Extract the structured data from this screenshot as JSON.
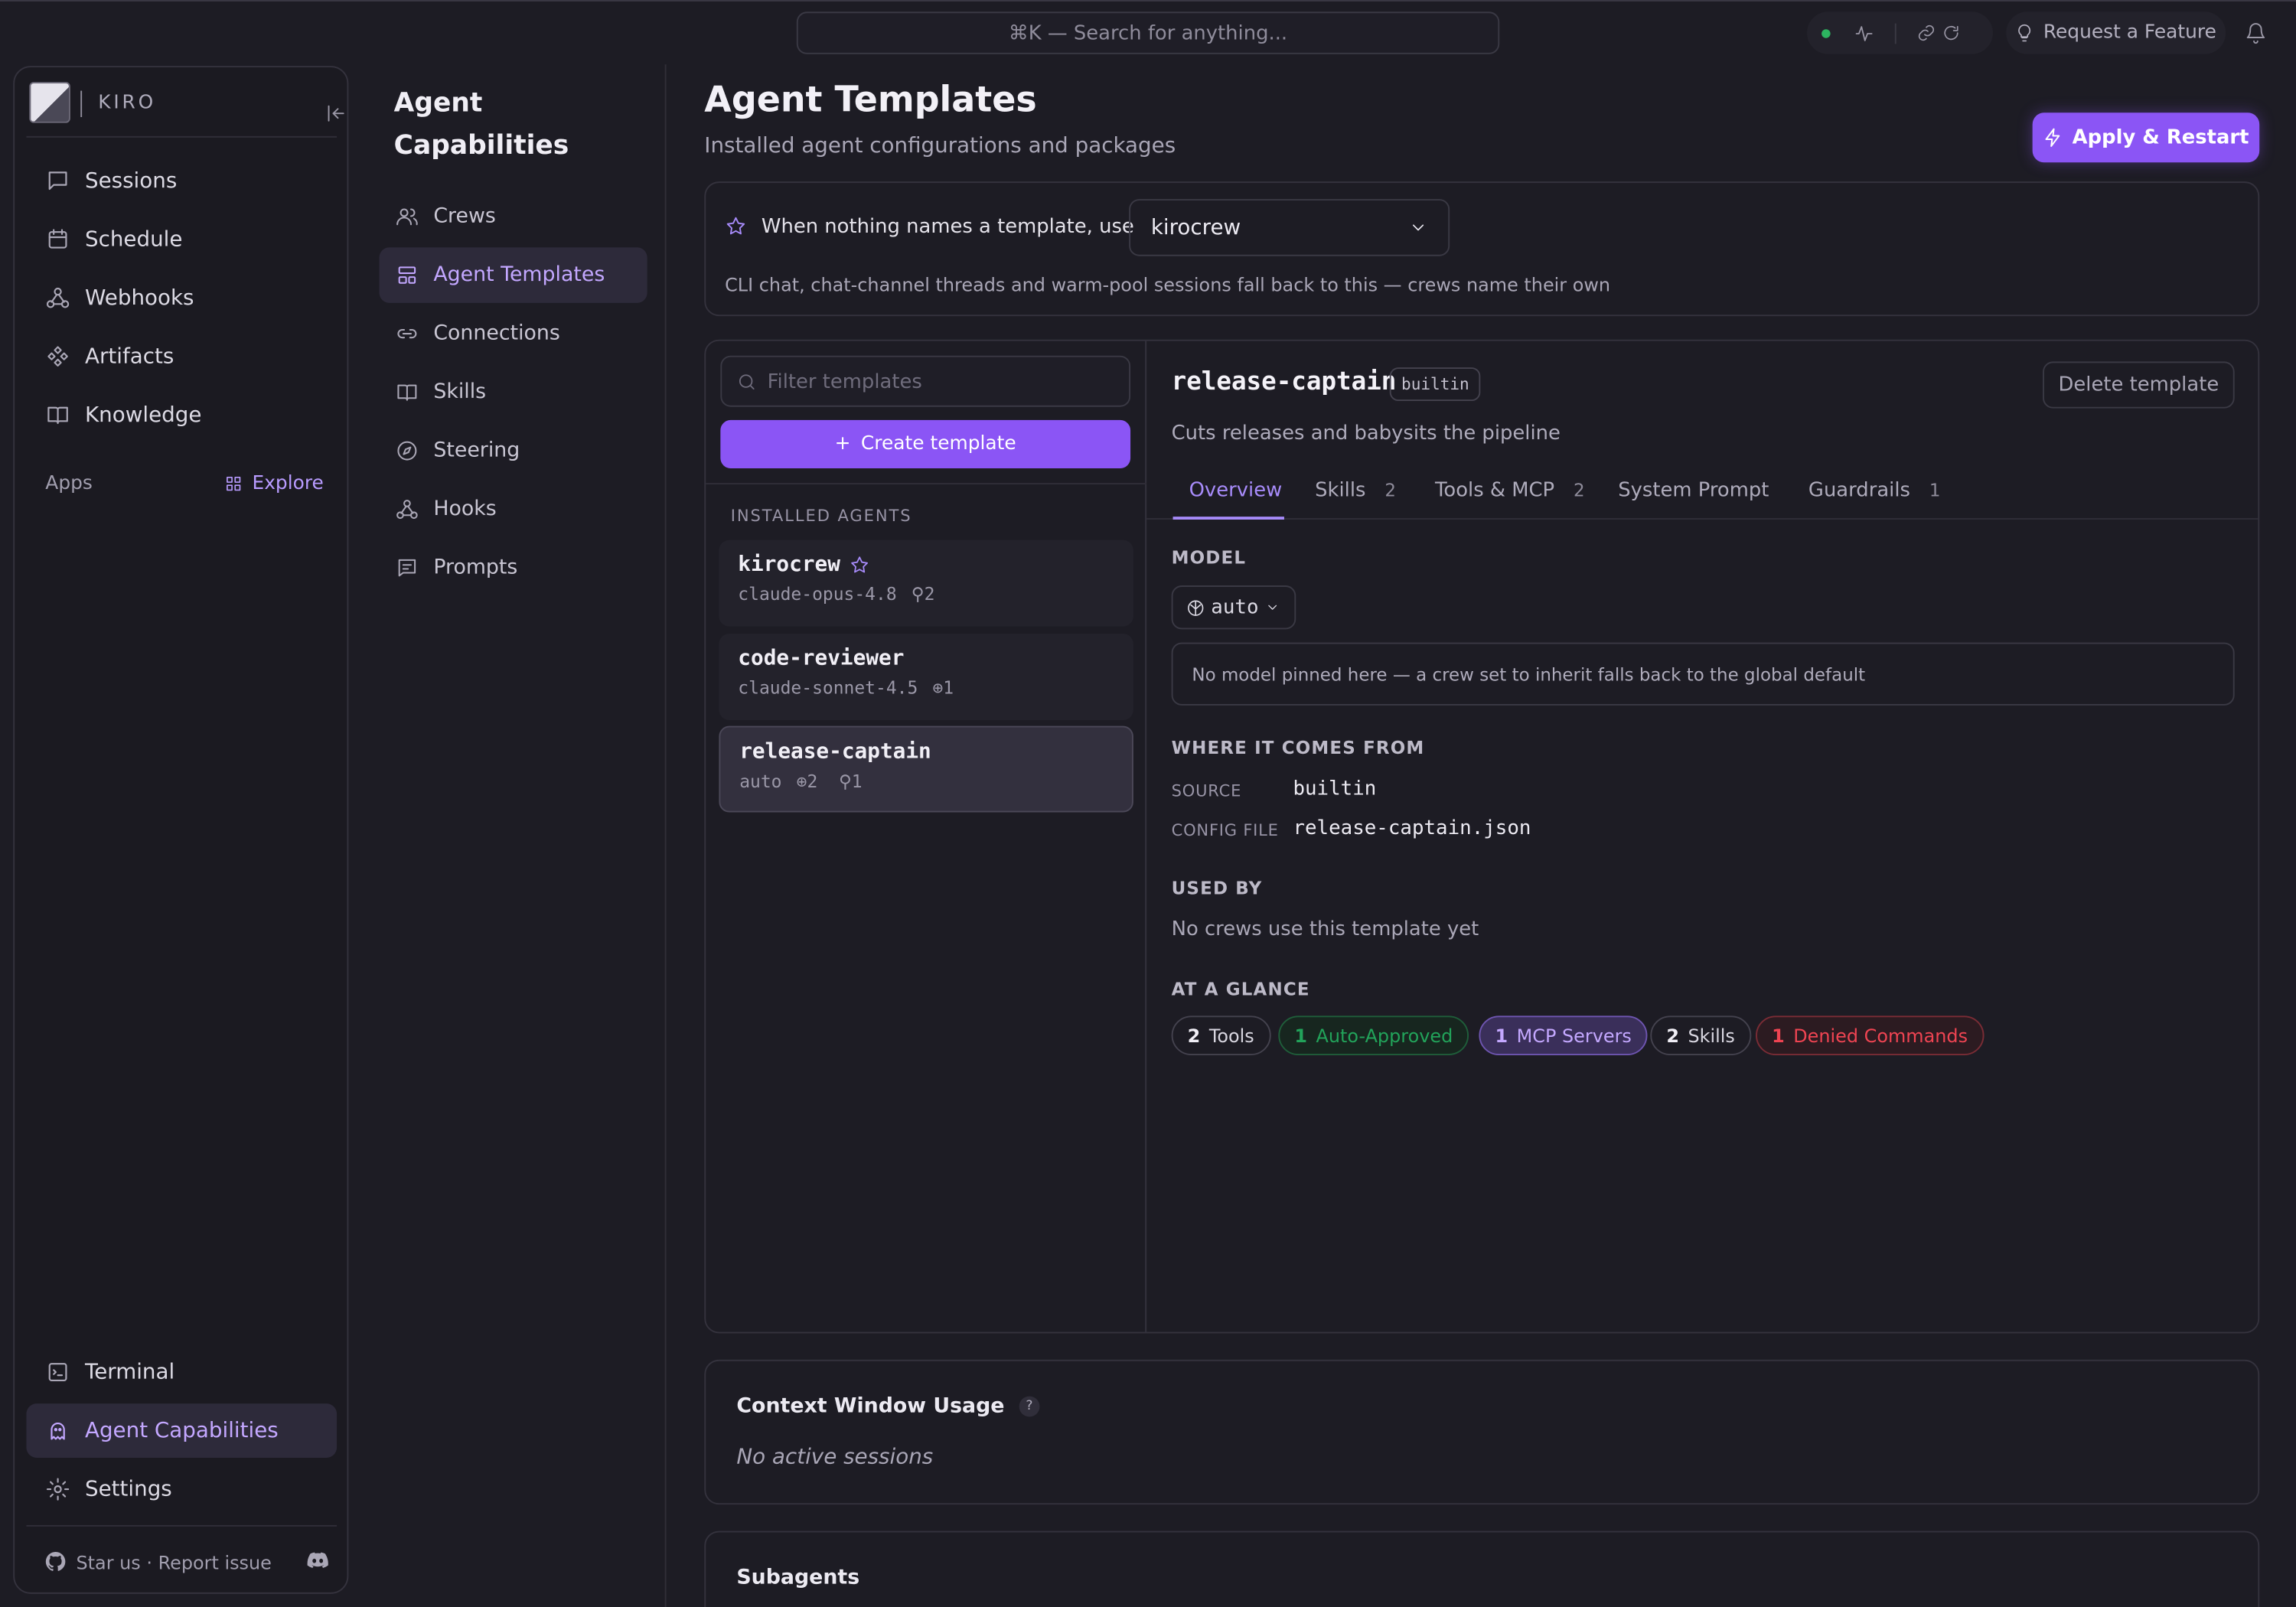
{
  "topbar": {
    "search_label": "⌘K — Search for anything...",
    "request_feature": "Request a Feature"
  },
  "sidebar": {
    "brand": "KIRO",
    "items": [
      {
        "label": "Sessions",
        "icon": "chat-icon"
      },
      {
        "label": "Schedule",
        "icon": "calendar-icon"
      },
      {
        "label": "Webhooks",
        "icon": "webhook-icon"
      },
      {
        "label": "Artifacts",
        "icon": "diamond-grid-icon"
      },
      {
        "label": "Knowledge",
        "icon": "book-icon"
      }
    ],
    "apps_label": "Apps",
    "explore_label": "Explore",
    "bottom_items": [
      {
        "label": "Terminal",
        "icon": "terminal-icon"
      },
      {
        "label": "Agent Capabilities",
        "icon": "ghost-icon",
        "active": true
      },
      {
        "label": "Settings",
        "icon": "gear-icon"
      }
    ],
    "footer_text": "Star us · Report issue"
  },
  "capabilities": {
    "title": "Agent Capabilities",
    "items": [
      {
        "label": "Crews",
        "icon": "users-icon"
      },
      {
        "label": "Agent Templates",
        "icon": "template-icon",
        "active": true
      },
      {
        "label": "Connections",
        "icon": "link-icon"
      },
      {
        "label": "Skills",
        "icon": "book-open-icon"
      },
      {
        "label": "Steering",
        "icon": "compass-icon"
      },
      {
        "label": "Hooks",
        "icon": "hook-icon"
      },
      {
        "label": "Prompts",
        "icon": "message-square-icon"
      }
    ]
  },
  "main": {
    "title": "Agent Templates",
    "subtitle": "Installed agent configurations and packages",
    "apply_button": "Apply & Restart",
    "default_label": "When nothing names a template, use",
    "default_value": "kirocrew",
    "default_note": "CLI chat, chat-channel threads and warm-pool sessions fall back to this — crews name their own",
    "filter_placeholder": "Filter templates",
    "create_button": "Create template",
    "installed_heading": "INSTALLED AGENTS",
    "agents": [
      {
        "name": "kirocrew",
        "model": "claude-opus-4.8",
        "stats": "⚲2",
        "default": true
      },
      {
        "name": "code-reviewer",
        "model": "claude-sonnet-4.5",
        "stats": "⊕1"
      },
      {
        "name": "release-captain",
        "model": "auto",
        "stats": "⊕2  ⚲1",
        "selected": true
      }
    ],
    "detail": {
      "name": "release-captain",
      "badge": "builtin",
      "delete_button": "Delete template",
      "description": "Cuts releases and babysits the pipeline",
      "tabs": [
        {
          "label": "Overview",
          "count": ""
        },
        {
          "label": "Skills",
          "count": "2"
        },
        {
          "label": "Tools & MCP",
          "count": "2"
        },
        {
          "label": "System Prompt",
          "count": ""
        },
        {
          "label": "Guardrails",
          "count": "1"
        }
      ],
      "model_heading": "MODEL",
      "model_value": "auto",
      "model_note": "No model pinned here — a crew set to inherit falls back to the global default",
      "origin_heading": "WHERE IT COMES FROM",
      "source_key": "SOURCE",
      "source_value": "builtin",
      "config_key": "CONFIG FILE",
      "config_value": "release-captain.json",
      "usedby_heading": "USED BY",
      "usedby_note": "No crews use this template yet",
      "glance_heading": "AT A GLANCE",
      "chips": [
        {
          "count": "2",
          "label": "Tools",
          "color": "#d8d6e0"
        },
        {
          "count": "1",
          "label": "Auto-Approved",
          "color": "#22a35a"
        },
        {
          "count": "1",
          "label": "MCP Servers",
          "color": "#b794ff"
        },
        {
          "count": "2",
          "label": "Skills",
          "color": "#d8d6e0"
        },
        {
          "count": "1",
          "label": "Denied Commands",
          "color": "#ef4452"
        }
      ]
    },
    "context": {
      "title": "Context Window Usage",
      "help": "?",
      "empty": "No active sessions"
    },
    "subagents_title": "Subagents"
  },
  "colors": {
    "accent": "#8b55f5",
    "background": "#1d1c24",
    "active_nav": "#2d2a3a"
  }
}
